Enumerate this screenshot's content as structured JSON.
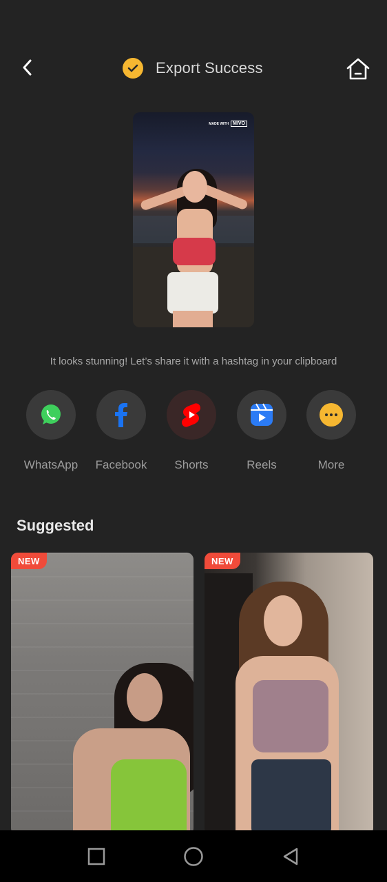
{
  "header": {
    "title": "Export Success",
    "back_icon": "chevron-left-icon",
    "status_icon": "check-circle-icon",
    "home_icon": "home-icon"
  },
  "preview": {
    "watermark": "MIVO",
    "watermark_small": "MADE WITH"
  },
  "caption": "It looks stunning! Let’s share it with a hashtag in your clipboard",
  "share_targets": [
    {
      "label": "WhatsApp",
      "icon": "whatsapp-icon",
      "color": "#3ecf5c"
    },
    {
      "label": "Facebook",
      "icon": "facebook-icon",
      "color": "#1a73f2"
    },
    {
      "label": "Shorts",
      "icon": "youtube-shorts-icon",
      "color": "#ff0000"
    },
    {
      "label": "Reels",
      "icon": "instagram-reels-icon",
      "color": "#2b7bf5"
    },
    {
      "label": "More",
      "icon": "more-dots-icon",
      "color": "#f6b731"
    }
  ],
  "suggested": {
    "title": "Suggested",
    "cards": [
      {
        "badge": "NEW"
      },
      {
        "badge": "NEW"
      }
    ]
  },
  "navbar": {
    "recents_icon": "square-icon",
    "home_icon": "circle-icon",
    "back_icon": "triangle-back-icon"
  },
  "colors": {
    "background": "#232323",
    "accent": "#f6b731",
    "badge": "#f04b3a"
  }
}
